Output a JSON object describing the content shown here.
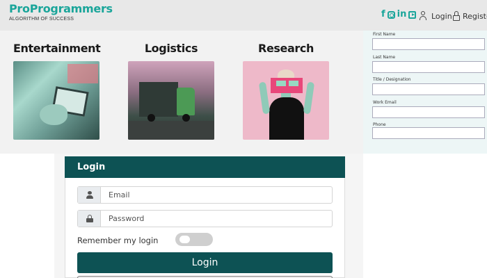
{
  "header": {
    "brand_title": "ProProgrammers",
    "brand_tagline": "ALGORITHM OF SUCCESS",
    "social": [
      "facebook-icon",
      "instagram-icon",
      "linkedin-icon",
      "youtube-icon"
    ],
    "login_label": "Login",
    "register_label": "Register"
  },
  "categories": [
    {
      "title": "Entertainment"
    },
    {
      "title": "Logistics"
    },
    {
      "title": "Research"
    }
  ],
  "side_form": {
    "fields": [
      {
        "label": "First Name"
      },
      {
        "label": "Last Name"
      },
      {
        "label": "Title / Designation"
      },
      {
        "label": "Work Email"
      },
      {
        "label": "Phone"
      }
    ]
  },
  "login": {
    "title": "Login",
    "email_placeholder": "Email",
    "password_placeholder": "Password",
    "remember_label": "Remember my login",
    "remember_on": false,
    "submit_label": "Login"
  },
  "colors": {
    "brand": "#1aa59a",
    "primary": "#0d5254"
  }
}
